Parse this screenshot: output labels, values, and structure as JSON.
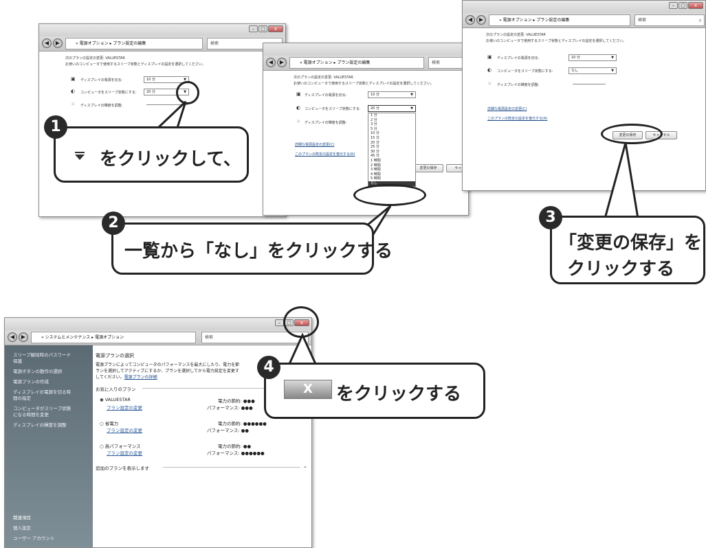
{
  "win1": {
    "breadcrumb": "« 電源オプション ▸ プラン設定の編集",
    "search_placeholder": "検索",
    "plan_heading": "次のプランの設定の変更: VALUESTAR",
    "plan_desc": "お使いのコンピュータで使用するスリープ状態とディスプレイの設定を選択してください。",
    "display_off_label": "ディスプレイの電源を切る:",
    "display_off_value": "10 分",
    "sleep_label": "コンピュータをスリープ状態にする:",
    "sleep_value": "20 分",
    "brightness_label": "ディスプレイの輝度を調整:"
  },
  "win2": {
    "breadcrumb": "« 電源オプション ▸ プラン設定の編集",
    "search_placeholder": "検索",
    "plan_heading": "次のプランの設定の変更: VALUESTAR",
    "plan_desc": "お使いのコンピュータで使用するスリープ状態とディスプレイの設定を選択してください。",
    "display_off_label": "ディスプレイの電源を切る:",
    "display_off_value": "10 分",
    "sleep_label": "コンピュータをスリープ状態にする:",
    "sleep_value": "20 分",
    "brightness_label": "ディスプレイの輝度を調整:",
    "advanced_link": "詳細な電源設定の変更(C)",
    "restore_link": "このプランの既定の設定を復元する(R)",
    "save_button": "変更の保存",
    "cancel_button": "キャン",
    "dropdown_options": [
      "1 分",
      "2 分",
      "3 分",
      "5 分",
      "10 分",
      "15 分",
      "20 分",
      "25 分",
      "30 分",
      "45 分",
      "1 時間",
      "2 時間",
      "3 時間",
      "4 時間",
      "5 時間",
      "なし"
    ],
    "dropdown_selected": "なし"
  },
  "win3": {
    "breadcrumb": "« 電源オプション ▸ プラン設定の編集",
    "search_placeholder": "検索",
    "plan_heading": "次のプランの設定の変更: VALUESTAR",
    "plan_desc": "お使いのコンピュータで使用するスリープ状態とディスプレイの設定を選択してください。",
    "display_off_label": "ディスプレイの電源を切る:",
    "display_off_value": "10 分",
    "sleep_label": "コンピュータをスリープ状態にする:",
    "sleep_value": "なし",
    "brightness_label": "ディスプレイの輝度を調整:",
    "advanced_link": "詳細な電源設定の変更(C)",
    "restore_link": "このプランの既定の設定を復元する(R)",
    "save_button": "変更の保存",
    "cancel_button": "キャンセル"
  },
  "win4": {
    "breadcrumb": "« システムとメンテナンス ▸ 電源オプション",
    "search_placeholder": "検索",
    "sidebar": [
      "スリープ解除時のパスワード",
      "保護",
      "電源ボタンの動作の選択",
      "電源プランの作成",
      "ディスプレイの電源を切る時",
      "間の指定",
      "コンピュータがスリープ状態",
      "になる時間を変更",
      "ディスプレイの輝度を調整"
    ],
    "sidebar_related": "関連項目",
    "sidebar_personal": "個人設定",
    "sidebar_user": "ユーザー アカウント",
    "main_title": "電源プランの選択",
    "main_desc1": "電源プランによってコンピュータのパフォーマンスを最大にしたり、電力を節",
    "main_desc2": "ランを選択してアクティブにするか、プランを選択してから電力設定を変更す",
    "main_desc3": "してください。",
    "main_desc_link": "電源プランの詳細",
    "favorites": "お気に入りのプラン",
    "plans": [
      {
        "name": "VALUESTAR",
        "change": "プラン設定の変更",
        "saving": "電力の節約: ●●●",
        "perf": "パフォーマンス: ●●●"
      },
      {
        "name": "省電力",
        "change": "プラン設定の変更",
        "saving": "電力の節約: ●●●●●●",
        "perf": "パフォーマンス: ●●"
      },
      {
        "name": "高パフォーマンス",
        "change": "プラン設定の変更",
        "saving": "電力の節約: ●●",
        "perf": "パフォーマンス: ●●●●●●"
      }
    ],
    "more_plans": "追加のプランを表示します"
  },
  "callouts": {
    "c1_num": "1",
    "c1_text": "をクリックして、",
    "c2_num": "2",
    "c2_text": "一覧から「なし」をクリックする",
    "c3_num": "3",
    "c3_line1": "「変更の保存」を",
    "c3_line2": "クリックする",
    "c4_num": "4",
    "c4_text": "をクリックする",
    "c4_button": "X"
  },
  "colors": {
    "callout_border": "#222222",
    "sidebar_bg": "#6c7b83",
    "dropdown_highlight": "#3a3a3a"
  }
}
